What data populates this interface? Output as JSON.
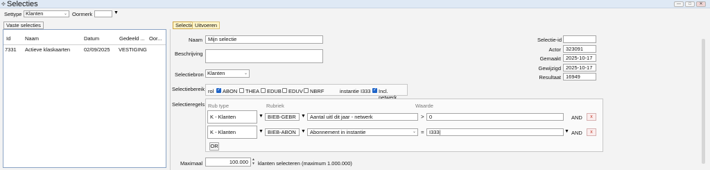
{
  "window": {
    "title": "Selecties",
    "btn_min": "—",
    "btn_max": "□",
    "btn_close": "✕"
  },
  "toolbar": {
    "settype_label": "Settype",
    "settype_value": "Klanten",
    "oormerk_label": "Oormerk",
    "oormerk_value": ""
  },
  "left": {
    "tab_label": "Vaste selecties",
    "columns": [
      "Id",
      "Naam",
      "Datum",
      "Gedeeld ...",
      "Oor..."
    ],
    "rows": [
      {
        "id": "7331",
        "naam": "Actieve klaskaarten",
        "datum": "02/09/2025",
        "gedeeld": "VESTIGING",
        "oormerk": ""
      }
    ]
  },
  "right": {
    "tabs": [
      "Selectie",
      "Uitvoeren"
    ],
    "naam_label": "Naam",
    "naam_value": "Mijn selectie",
    "beschrijving_label": "Beschrijving",
    "beschrijving_value": "",
    "selectiebron_label": "Selectiebron",
    "selectiebron_value": "Klanten",
    "selectiebereik_label": "Selectiebereik",
    "bereik": {
      "rol_label": "rol",
      "checks": [
        {
          "label": "ABON",
          "checked": true
        },
        {
          "label": "THEA",
          "checked": false
        },
        {
          "label": "EDUB",
          "checked": false
        },
        {
          "label": "EDUV",
          "checked": false
        },
        {
          "label": "NBRF",
          "checked": false
        }
      ],
      "instantie_label": "instantie",
      "instantie_value": "I333",
      "incl_netwerk_label": "Incl. netwerk",
      "incl_netwerk_checked": true
    },
    "selectieregels_label": "Selectieregels",
    "regels_headers": {
      "rub_type": "Rub type",
      "rubriek": "Rubriek",
      "waarde": "Waarde"
    },
    "regels": [
      {
        "rub_type": "K - Klanten",
        "rubriek_code": "BIEB-GEBR",
        "rubriek_naam": "Aantal uitl dit jaar - netwerk",
        "operator": ">",
        "waarde": "0",
        "connector": "AND",
        "remove": "x"
      },
      {
        "rub_type": "K - Klanten",
        "rubriek_code": "BIEB-ABON",
        "rubriek_naam": "Abonnement in instantie",
        "operator": "=",
        "waarde": "I333|",
        "connector": "AND",
        "remove": "x"
      }
    ],
    "or_button": "OR",
    "maximaal_label": "Maximaal",
    "maximaal_value": "100.000",
    "maximaal_suffix": "klanten selecteren (maximum 1.000.000)",
    "info": {
      "selectie_id_label": "Selectie-id",
      "selectie_id": "",
      "actor_label": "Actor",
      "actor": "323091",
      "gemaakt_label": "Gemaakt",
      "gemaakt": "2025-10-17",
      "gewijzigd_label": "Gewijzigd",
      "gewijzigd": "2025-10-17",
      "resultaat_label": "Resultaat",
      "resultaat": "16949"
    }
  }
}
